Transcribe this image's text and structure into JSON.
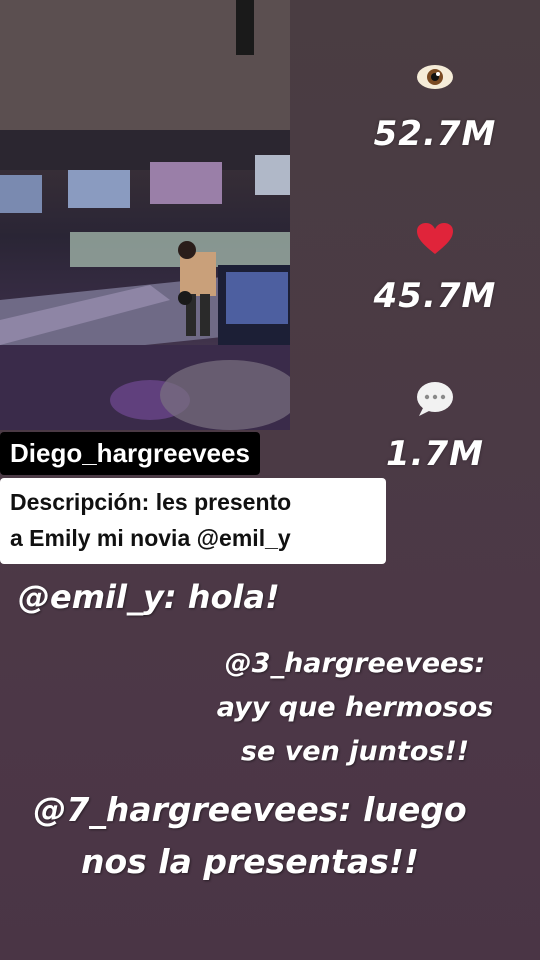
{
  "stats": {
    "views": {
      "icon": "eye-icon",
      "value": "52.7M"
    },
    "likes": {
      "icon": "heart-icon",
      "value": "45.7M"
    },
    "comments": {
      "icon": "speech-bubble-icon",
      "value": "1.7M"
    }
  },
  "post": {
    "username": "Diego_hargreevees",
    "description_line1": "Descripción: les presento",
    "description_line2": "a Emily mi novia @emil_y"
  },
  "comments": [
    {
      "text": "@emil_y: hola!"
    },
    {
      "line1": "@3_hargreevees:",
      "line2": "ayy que hermosos",
      "line3": "se ven juntos!!"
    },
    {
      "line1": "@7_hargreevees: luego",
      "line2": "nos la presentas!!"
    }
  ],
  "colors": {
    "heart": "#e0243a",
    "background": "#4b3a45"
  }
}
